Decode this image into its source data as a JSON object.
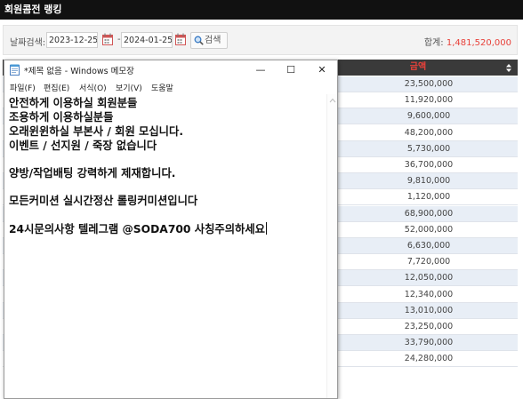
{
  "page": {
    "title": "회원콤전 랭킹"
  },
  "filter": {
    "label": "날짜검색:",
    "start_date": "2023-12-25",
    "separator": "-",
    "end_date": "2024-01-25",
    "search_label": "검색",
    "total_label": "합계:",
    "total_amount": "1,481,520,000"
  },
  "table": {
    "amount_header": "금액",
    "amounts": [
      "23,500,000",
      "11,920,000",
      "9,600,000",
      "48,200,000",
      "5,730,000",
      "36,700,000",
      "9,810,000",
      "1,120,000",
      "68,900,000",
      "52,000,000",
      "6,630,000",
      "7,720,000",
      "12,050,000",
      "12,340,000",
      "13,010,000",
      "23,250,000",
      "33,790,000",
      "24,280,000"
    ]
  },
  "notepad": {
    "title": "*제목 없음 - Windows 메모장",
    "controls": {
      "minimize": "—",
      "maximize": "☐",
      "close": "✕"
    },
    "menu": [
      "파일(F)",
      "편집(E)",
      "서식(O)",
      "보기(V)",
      "도움말"
    ],
    "lines": [
      "안전하게 이용하실 회원분들",
      "조용하게 이용하실분들",
      "오래윈윈하실 부본사 / 회원 모십니다.",
      "이벤트 / 선지원 / 죽장 없습니다",
      "",
      "양방/작업배팅 강력하게 제재합니다.",
      "",
      "모든커미션 실시간정산 롤링커미션입니다",
      "",
      "24시문의사항 텔레그램 @SODA700 사칭주의하세요"
    ]
  },
  "colors": {
    "topbar": "#111111",
    "accent": "#e8413a",
    "row_alt": "#e8eef6"
  }
}
